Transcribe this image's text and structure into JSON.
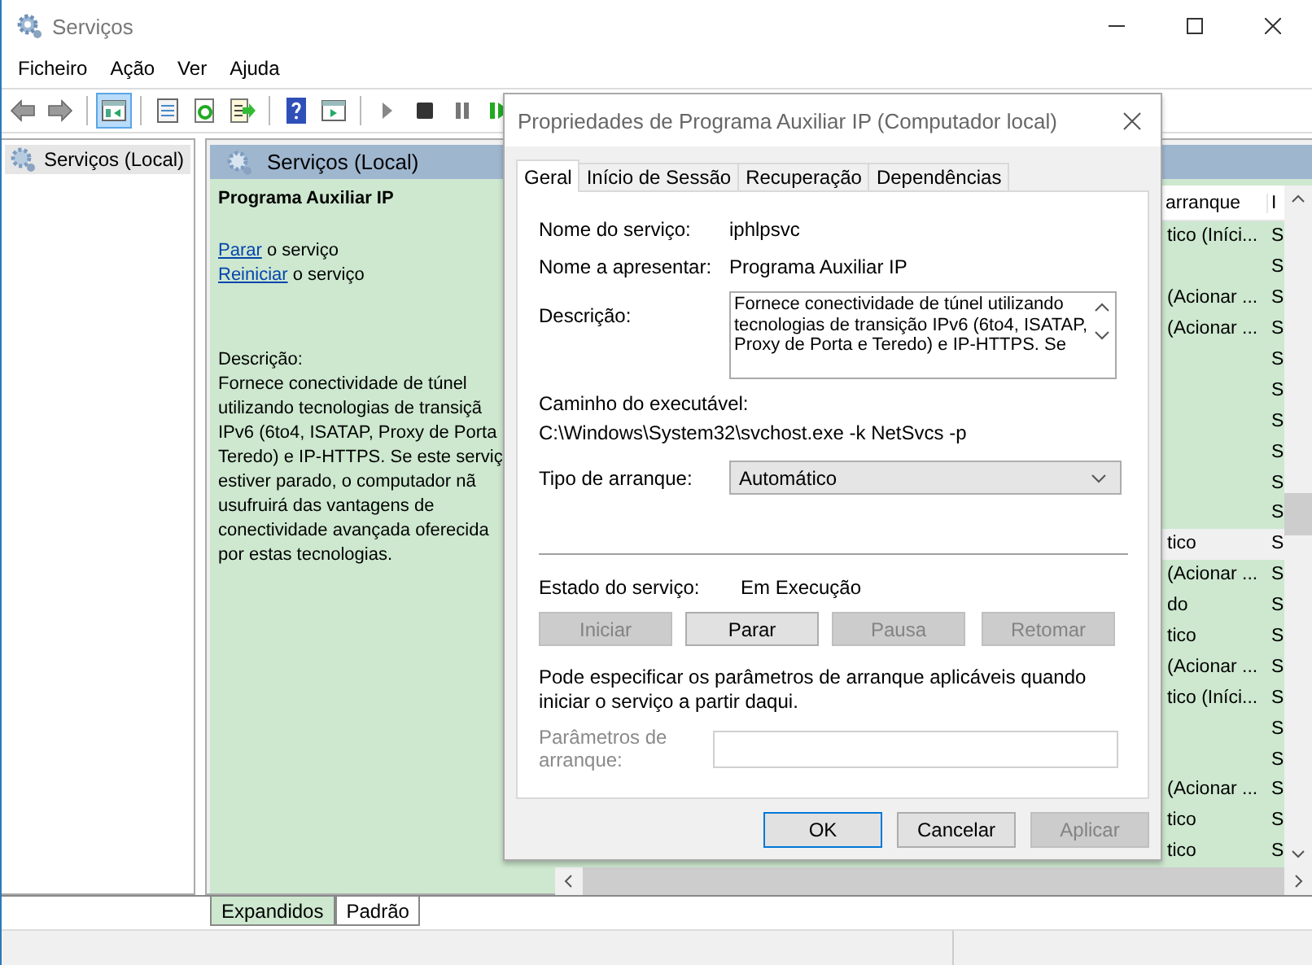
{
  "window": {
    "title": "Serviços"
  },
  "menu": [
    "Ficheiro",
    "Ação",
    "Ver",
    "Ajuda"
  ],
  "toolbar": [
    {
      "kind": "back",
      "selected": false
    },
    {
      "kind": "forward",
      "selected": false
    },
    {
      "kind": "separator"
    },
    {
      "kind": "tree",
      "selected": true
    },
    {
      "kind": "separator"
    },
    {
      "kind": "properties",
      "selected": false
    },
    {
      "kind": "refresh",
      "selected": false
    },
    {
      "kind": "export",
      "selected": false
    },
    {
      "kind": "separator"
    },
    {
      "kind": "help",
      "selected": false
    },
    {
      "kind": "view",
      "selected": false
    },
    {
      "kind": "separator"
    },
    {
      "kind": "play",
      "selected": false
    },
    {
      "kind": "stop",
      "selected": false
    },
    {
      "kind": "pause",
      "selected": false
    },
    {
      "kind": "resume",
      "selected": false
    }
  ],
  "tree": [
    {
      "label": "Serviços (Local)",
      "selected": true
    }
  ],
  "pane": {
    "title": "Serviços (Local)",
    "service_name": "Programa Auxiliar IP",
    "actions": [
      {
        "link": "Parar",
        "text": "o serviço"
      },
      {
        "link": "Reiniciar",
        "text": "o serviço"
      }
    ],
    "description_label": "Descrição:",
    "description_lines": [
      "Fornece conectividade de túnel",
      "utilizando tecnologias de transiçã",
      "IPv6 (6to4, ISATAP, Proxy de Porta",
      "Teredo) e IP-HTTPS. Se este serviç",
      "estiver parado, o computador nã",
      "usufruirá das vantagens de",
      "conectividade avançada oferecida",
      "por estas tecnologias."
    ]
  },
  "list": {
    "columns": [
      "arranque",
      "I"
    ],
    "rows": [
      {
        "column_1": "tico (Iníci...",
        "column_2": "S",
        "selected": false
      },
      {
        "column_2": "S",
        "selected": false
      },
      {
        "column_1": "(Acionar ...",
        "column_2": "S",
        "selected": false
      },
      {
        "column_1": "(Acionar ...",
        "column_2": "S",
        "selected": false
      },
      {
        "column_2": "S",
        "selected": false
      },
      {
        "column_2": "S",
        "selected": false
      },
      {
        "column_2": "S",
        "selected": false
      },
      {
        "column_2": "S",
        "selected": false
      },
      {
        "column_2": "S",
        "selected": false
      },
      {
        "column_2": "S",
        "selected": false
      },
      {
        "column_1": "tico",
        "column_2": "S",
        "selected": true
      },
      {
        "column_1": "(Acionar ...",
        "column_2": "S",
        "selected": false
      },
      {
        "column_1": "do",
        "column_2": "S",
        "selected": false
      },
      {
        "column_1": "tico",
        "column_2": "S",
        "selected": false
      },
      {
        "column_1": "(Acionar ...",
        "column_2": "S",
        "selected": false
      },
      {
        "column_1": "tico (Iníci...",
        "column_2": "S",
        "selected": false
      },
      {
        "column_2": "S",
        "selected": false
      },
      {
        "column_2": "S",
        "selected": false
      },
      {
        "column_1": "(Acionar ...",
        "column_2": "S",
        "selected": false
      },
      {
        "column_1": "tico",
        "column_2": "S",
        "selected": false
      },
      {
        "column_1": "tico",
        "column_2": "S",
        "selected": false
      }
    ]
  },
  "view_tabs": [
    {
      "label": "Expandidos",
      "selected": true
    },
    {
      "label": "Padrão",
      "selected": false
    }
  ],
  "dialog": {
    "title": "Propriedades de Programa Auxiliar IP (Computador local)",
    "tabs": [
      {
        "label": "Geral",
        "selected": true
      },
      {
        "label": "Início de Sessão",
        "selected": false
      },
      {
        "label": "Recuperação",
        "selected": false
      },
      {
        "label": "Dependências",
        "selected": false
      }
    ],
    "fields": [
      {
        "label": "Nome do serviço:",
        "value": "iphlpsvc"
      },
      {
        "label": "Nome a apresentar:",
        "value": "Programa Auxiliar IP"
      }
    ],
    "description": {
      "label": "Descrição:",
      "value": "Fornece conectividade de túnel utilizando tecnologias de transição IPv6 (6to4, ISATAP, Proxy de Porta e Teredo) e IP-HTTPS. Se"
    },
    "path": {
      "label": "Caminho do executável:",
      "value": "C:\\Windows\\System32\\svchost.exe -k NetSvcs -p"
    },
    "startup": {
      "label": "Tipo de arranque:",
      "value": "Automático"
    },
    "status": {
      "label": "Estado do serviço:",
      "value": "Em Execução"
    },
    "service_buttons": [
      {
        "label": "Iniciar",
        "disabled": true
      },
      {
        "label": "Parar",
        "disabled": false
      },
      {
        "label": "Pausa",
        "disabled": true
      },
      {
        "label": "Retomar",
        "disabled": true
      }
    ],
    "note": "Pode especificar os parâmetros de arranque aplicáveis quando iniciar o serviço a partir daqui.",
    "params": {
      "label": "Parâmetros de arranque:",
      "disabled": true
    },
    "buttons": [
      {
        "label": "OK",
        "disabled": false
      },
      {
        "label": "Cancelar",
        "disabled": false
      },
      {
        "label": "Aplicar",
        "disabled": true
      }
    ]
  }
}
